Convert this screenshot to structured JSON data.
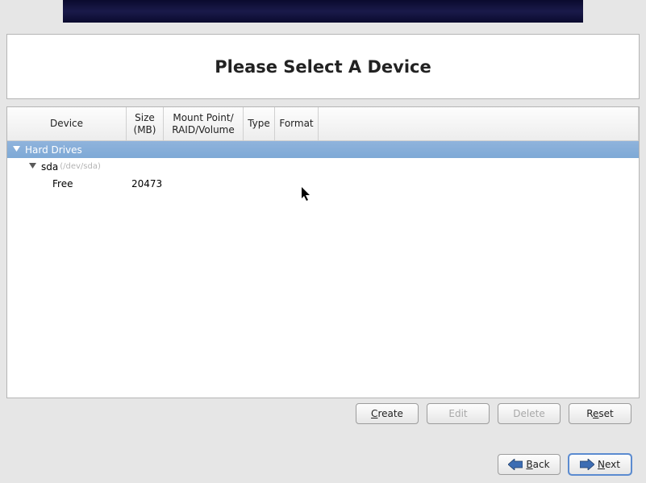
{
  "title": "Please Select A Device",
  "columns": {
    "device": "Device",
    "size": "Size\n(MB)",
    "mount": "Mount Point/\nRAID/Volume",
    "type": "Type",
    "format": "Format"
  },
  "tree": {
    "group_label": "Hard Drives",
    "disk": {
      "name": "sda",
      "devpath": "(/dev/sda)"
    },
    "free_row": {
      "label": "Free",
      "size": "20473"
    }
  },
  "buttons": {
    "create": "Create",
    "edit": "Edit",
    "delete": "Delete",
    "reset": "Reset",
    "back": "Back",
    "next": "Next"
  }
}
